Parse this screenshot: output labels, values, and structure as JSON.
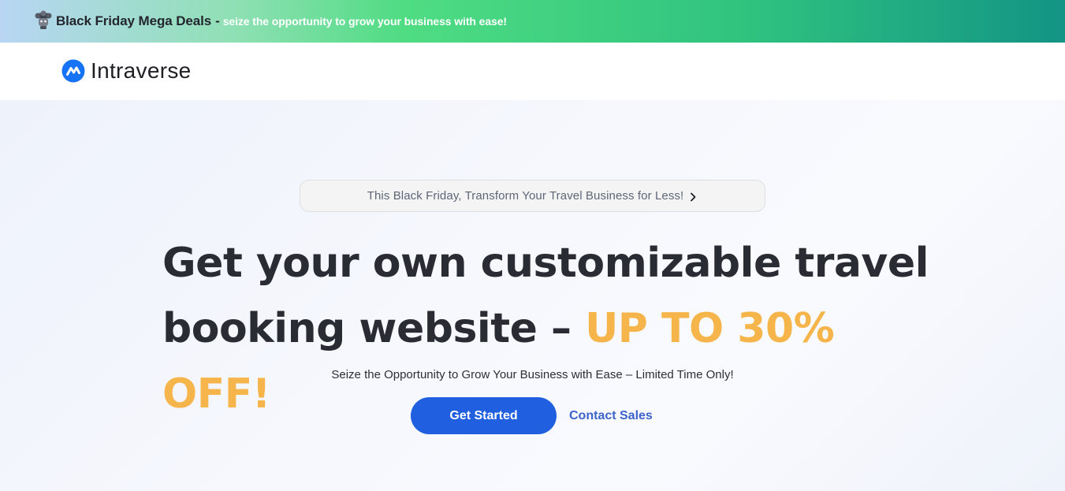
{
  "banner": {
    "icon": "graduation-cap-mascot-icon",
    "title": "Black Friday Mega Deals",
    "separator": "-",
    "subtitle": "seize the opportunity to grow your business with ease!"
  },
  "header": {
    "logo_icon": "intraverse-logo-mark",
    "logo_text": "Intraverse",
    "brand_color": "#1673f5"
  },
  "hero": {
    "announcement": "This Black Friday, Transform Your Travel Business for Less!",
    "announcement_icon": "chevron-right-icon",
    "heading_main": "Get your own customizable travel booking website – ",
    "heading_accent": "UP TO 30% OFF!",
    "accent_color": "#f6b54b",
    "subtitle": "Seize the Opportunity to Grow Your Business with Ease – Limited Time Only!",
    "primary_cta": "Get Started",
    "secondary_cta": "Contact Sales",
    "primary_color": "#1f5fe0"
  }
}
